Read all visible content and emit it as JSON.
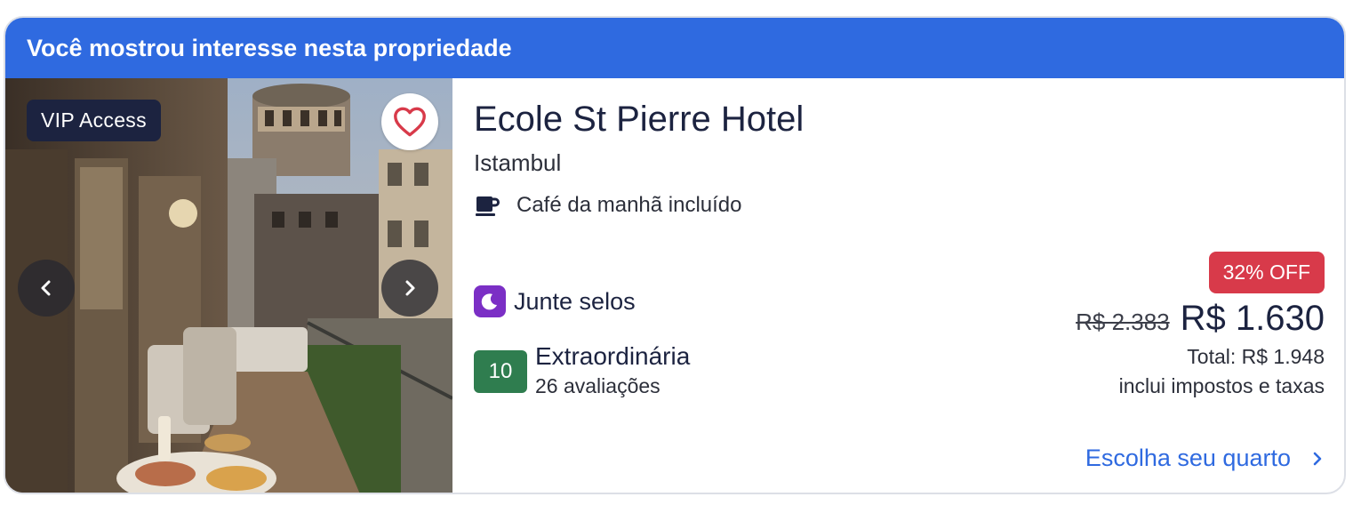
{
  "banner": {
    "text": "Você mostrou interesse nesta propriedade",
    "color": "#2f6ae0"
  },
  "photo": {
    "badge": "VIP Access",
    "favorite_icon": "heart-icon",
    "prev_icon": "chevron-left-icon",
    "next_icon": "chevron-right-icon"
  },
  "hotel": {
    "name": "Ecole St Pierre Hotel",
    "city": "Istambul",
    "amenity": {
      "icon": "coffee-cup-icon",
      "label": "Café da manhã incluído"
    },
    "rewards": {
      "icon": "moon-icon",
      "label": "Junte selos",
      "color": "#7b2fc5"
    },
    "rating": {
      "score": "10",
      "label": "Extraordinária",
      "reviews": "26 avaliações",
      "color": "#2f7d4f"
    }
  },
  "pricing": {
    "discount_badge": "32% OFF",
    "discount_color": "#d83a4a",
    "old_price": "R$ 2.383",
    "new_price": "R$ 1.630",
    "total": "Total: R$ 1.948",
    "taxes_note": "inclui impostos e taxas"
  },
  "cta": {
    "label": "Escolha seu quarto",
    "icon": "chevron-right-icon",
    "color": "#2f6ae0"
  }
}
